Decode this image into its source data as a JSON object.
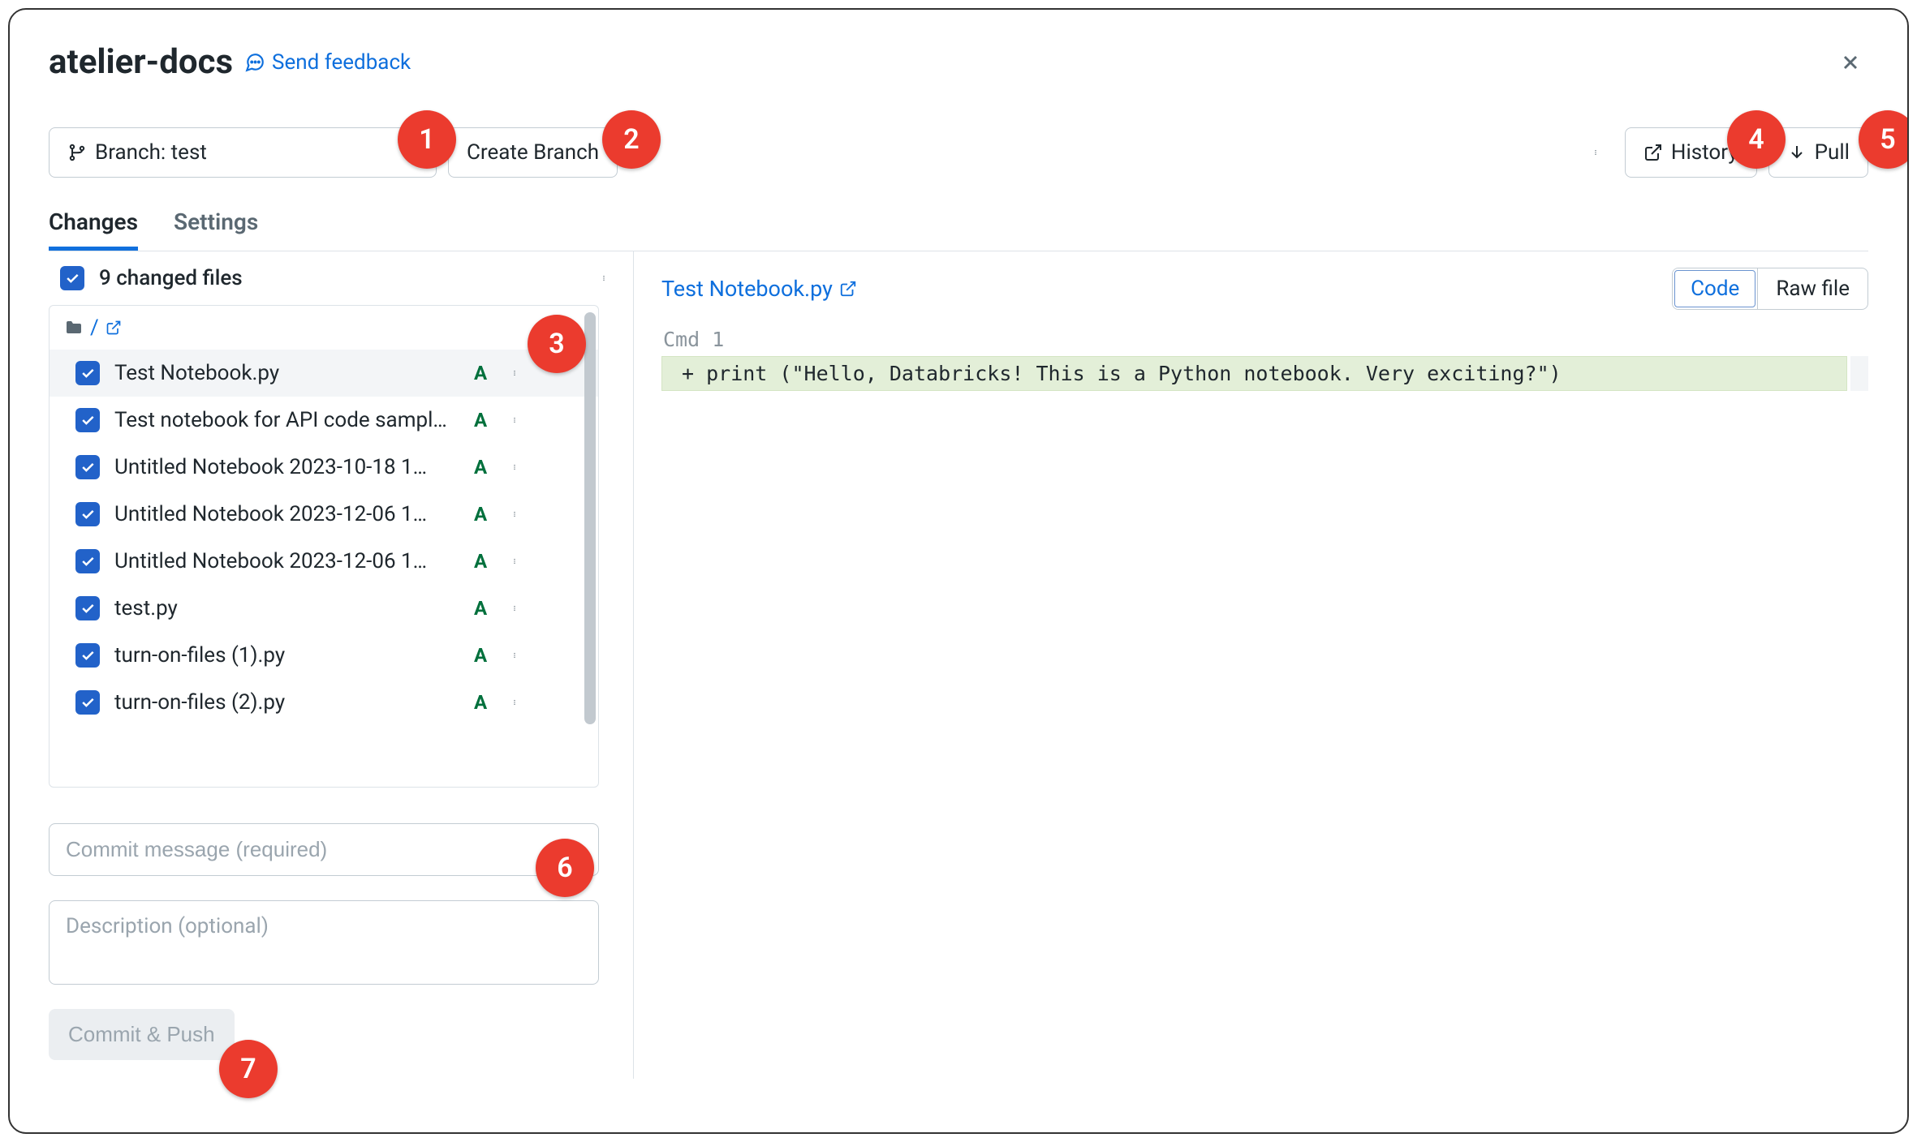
{
  "title": "atelier-docs",
  "feedback_label": "Send feedback",
  "close_label": "Close",
  "branch_label": "Branch: test",
  "create_branch_label": "Create Branch",
  "history_label": "History",
  "pull_label": "Pull",
  "tabs": {
    "changes": "Changes",
    "settings": "Settings"
  },
  "summary_text": "9 changed files",
  "root_path": "/",
  "files": [
    {
      "name": "Test Notebook.py",
      "status": "A",
      "selected": true
    },
    {
      "name": "Test notebook for API code sampl…",
      "status": "A",
      "selected": false
    },
    {
      "name": "Untitled Notebook 2023-10-18 1…",
      "status": "A",
      "selected": false
    },
    {
      "name": "Untitled Notebook 2023-12-06 1…",
      "status": "A",
      "selected": false
    },
    {
      "name": "Untitled Notebook 2023-12-06 1…",
      "status": "A",
      "selected": false
    },
    {
      "name": "test.py",
      "status": "A",
      "selected": false
    },
    {
      "name": "turn-on-files (1).py",
      "status": "A",
      "selected": false
    },
    {
      "name": "turn-on-files (2).py",
      "status": "A",
      "selected": false
    }
  ],
  "commit_message_placeholder": "Commit message (required)",
  "description_placeholder": "Description (optional)",
  "commit_push_label": "Commit & Push",
  "diff": {
    "file_link": "Test Notebook.py",
    "view_code": "Code",
    "view_raw": "Raw file",
    "cmd_label": "Cmd 1",
    "added_line": "+ print (\"Hello, Databricks! This is a Python notebook. Very exciting?\")"
  },
  "callouts": {
    "1": "1",
    "2": "2",
    "3": "3",
    "4": "4",
    "5": "5",
    "6": "6",
    "7": "7"
  }
}
